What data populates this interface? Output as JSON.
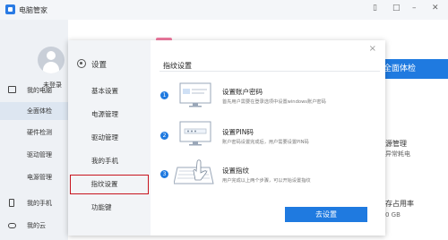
{
  "app": {
    "title": "电脑管家",
    "window_controls": [
      "▯",
      "□",
      "–",
      "✕"
    ]
  },
  "sidebar": {
    "login": "未登录",
    "items": [
      {
        "label": "我的电脑"
      },
      {
        "label": "全面体检"
      },
      {
        "label": "硬件检测"
      },
      {
        "label": "驱动管理"
      },
      {
        "label": "电源管理"
      },
      {
        "label": "我的手机"
      },
      {
        "label": "我的云"
      }
    ]
  },
  "main": {
    "check_button": "全面体检",
    "power_title": "源管理",
    "power_sub": "异常耗电",
    "storage_title": "存占用率",
    "storage_sub": "0 GB"
  },
  "dialog": {
    "side_title": "设置",
    "menu": [
      {
        "label": "基本设置"
      },
      {
        "label": "电源管理"
      },
      {
        "label": "驱动管理"
      },
      {
        "label": "我的手机"
      },
      {
        "label": "指纹设置"
      },
      {
        "label": "功能键"
      }
    ],
    "selected_menu": "指纹设置",
    "close": "×",
    "content_title": "指纹设置",
    "steps": [
      {
        "num": "1",
        "title": "设置账户密码",
        "desc": "首先用户需要在登录选项中设置windows账户密码"
      },
      {
        "num": "2",
        "title": "设置PIN码",
        "desc": "账户密码设置完成后，用户需要设置PIN码"
      },
      {
        "num": "3",
        "title": "设置指纹",
        "desc": "用户完成以上两个步骤，可以开始设置指纹"
      }
    ],
    "setup_button": "去设置"
  },
  "colors": {
    "accent": "#1f7ae0",
    "selected_border": "#c8141e",
    "sidebar_bg": "#eef1f5"
  }
}
